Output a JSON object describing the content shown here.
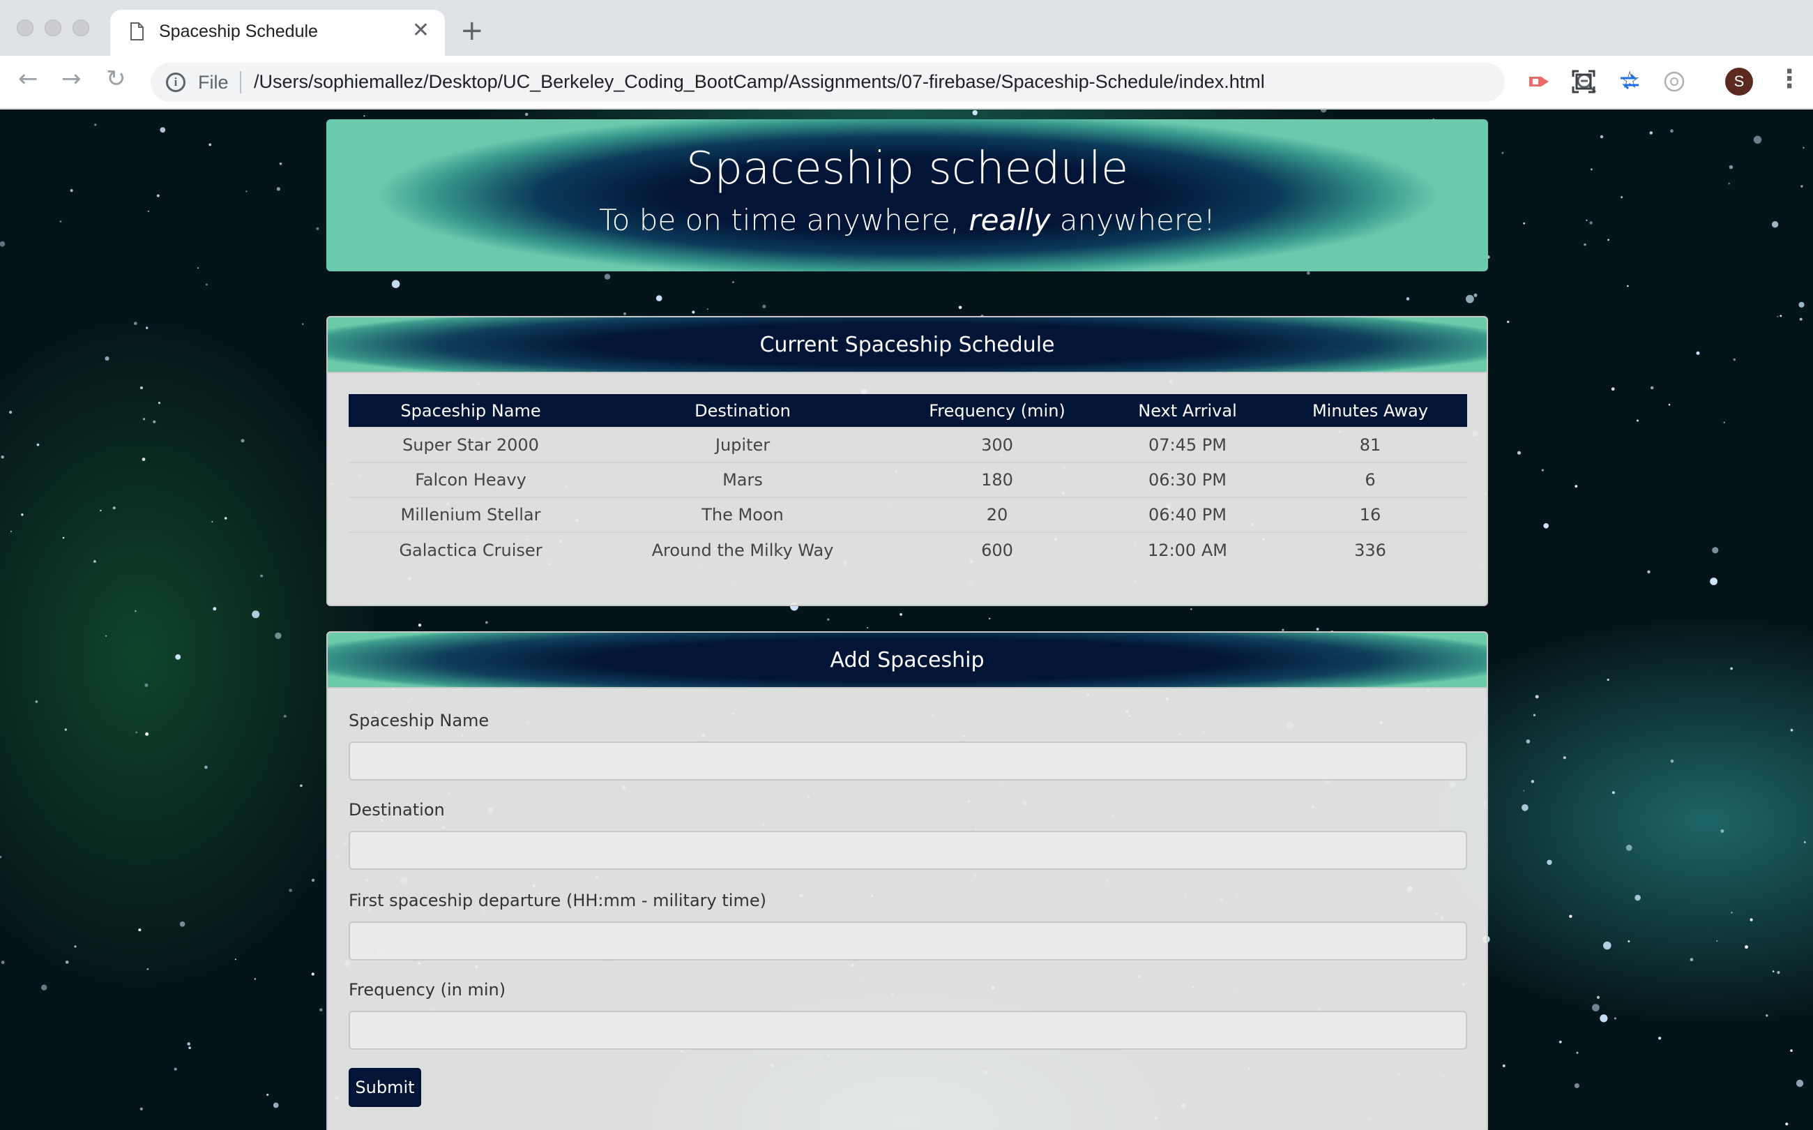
{
  "browser": {
    "tab_title": "Spaceship Schedule",
    "address_scheme": "File",
    "address_url": "/Users/sophiemallez/Desktop/UC_Berkeley_Coding_BootCamp/Assignments/07-firebase/Spaceship-Schedule/index.html",
    "profile_initial": "S",
    "icons": [
      "back-icon",
      "forward-icon",
      "reload-icon",
      "info-icon",
      "zoom-icon",
      "star-icon",
      "extension-icon",
      "avatar",
      "menu-icon"
    ]
  },
  "page": {
    "title": "Spaceship schedule",
    "subtitle_before": "To be on time anywhere, ",
    "subtitle_emphasis": "really",
    "subtitle_after": " anywhere!"
  },
  "schedule": {
    "header": "Current Spaceship Schedule",
    "columns": [
      "Spaceship Name",
      "Destination",
      "Frequency (min)",
      "Next Arrival",
      "Minutes Away"
    ],
    "rows": [
      [
        "Super Star 2000",
        "Jupiter",
        "300",
        "07:45 PM",
        "81"
      ],
      [
        "Falcon Heavy",
        "Mars",
        "180",
        "06:30 PM",
        "6"
      ],
      [
        "Millenium Stellar",
        "The Moon",
        "20",
        "06:40 PM",
        "16"
      ],
      [
        "Galactica Cruiser",
        "Around the Milky Way",
        "600",
        "12:00 AM",
        "336"
      ]
    ]
  },
  "form": {
    "header": "Add Spaceship",
    "name_label": "Spaceship Name",
    "destination_label": "Destination",
    "departure_label": "First spaceship departure (HH:mm - military time)",
    "frequency_label": "Frequency (in min)",
    "name_value": "",
    "destination_value": "",
    "departure_value": "",
    "frequency_value": "",
    "submit_label": "Submit"
  },
  "colors": {
    "navy": "#021537",
    "teal": "#6cc9ad"
  }
}
